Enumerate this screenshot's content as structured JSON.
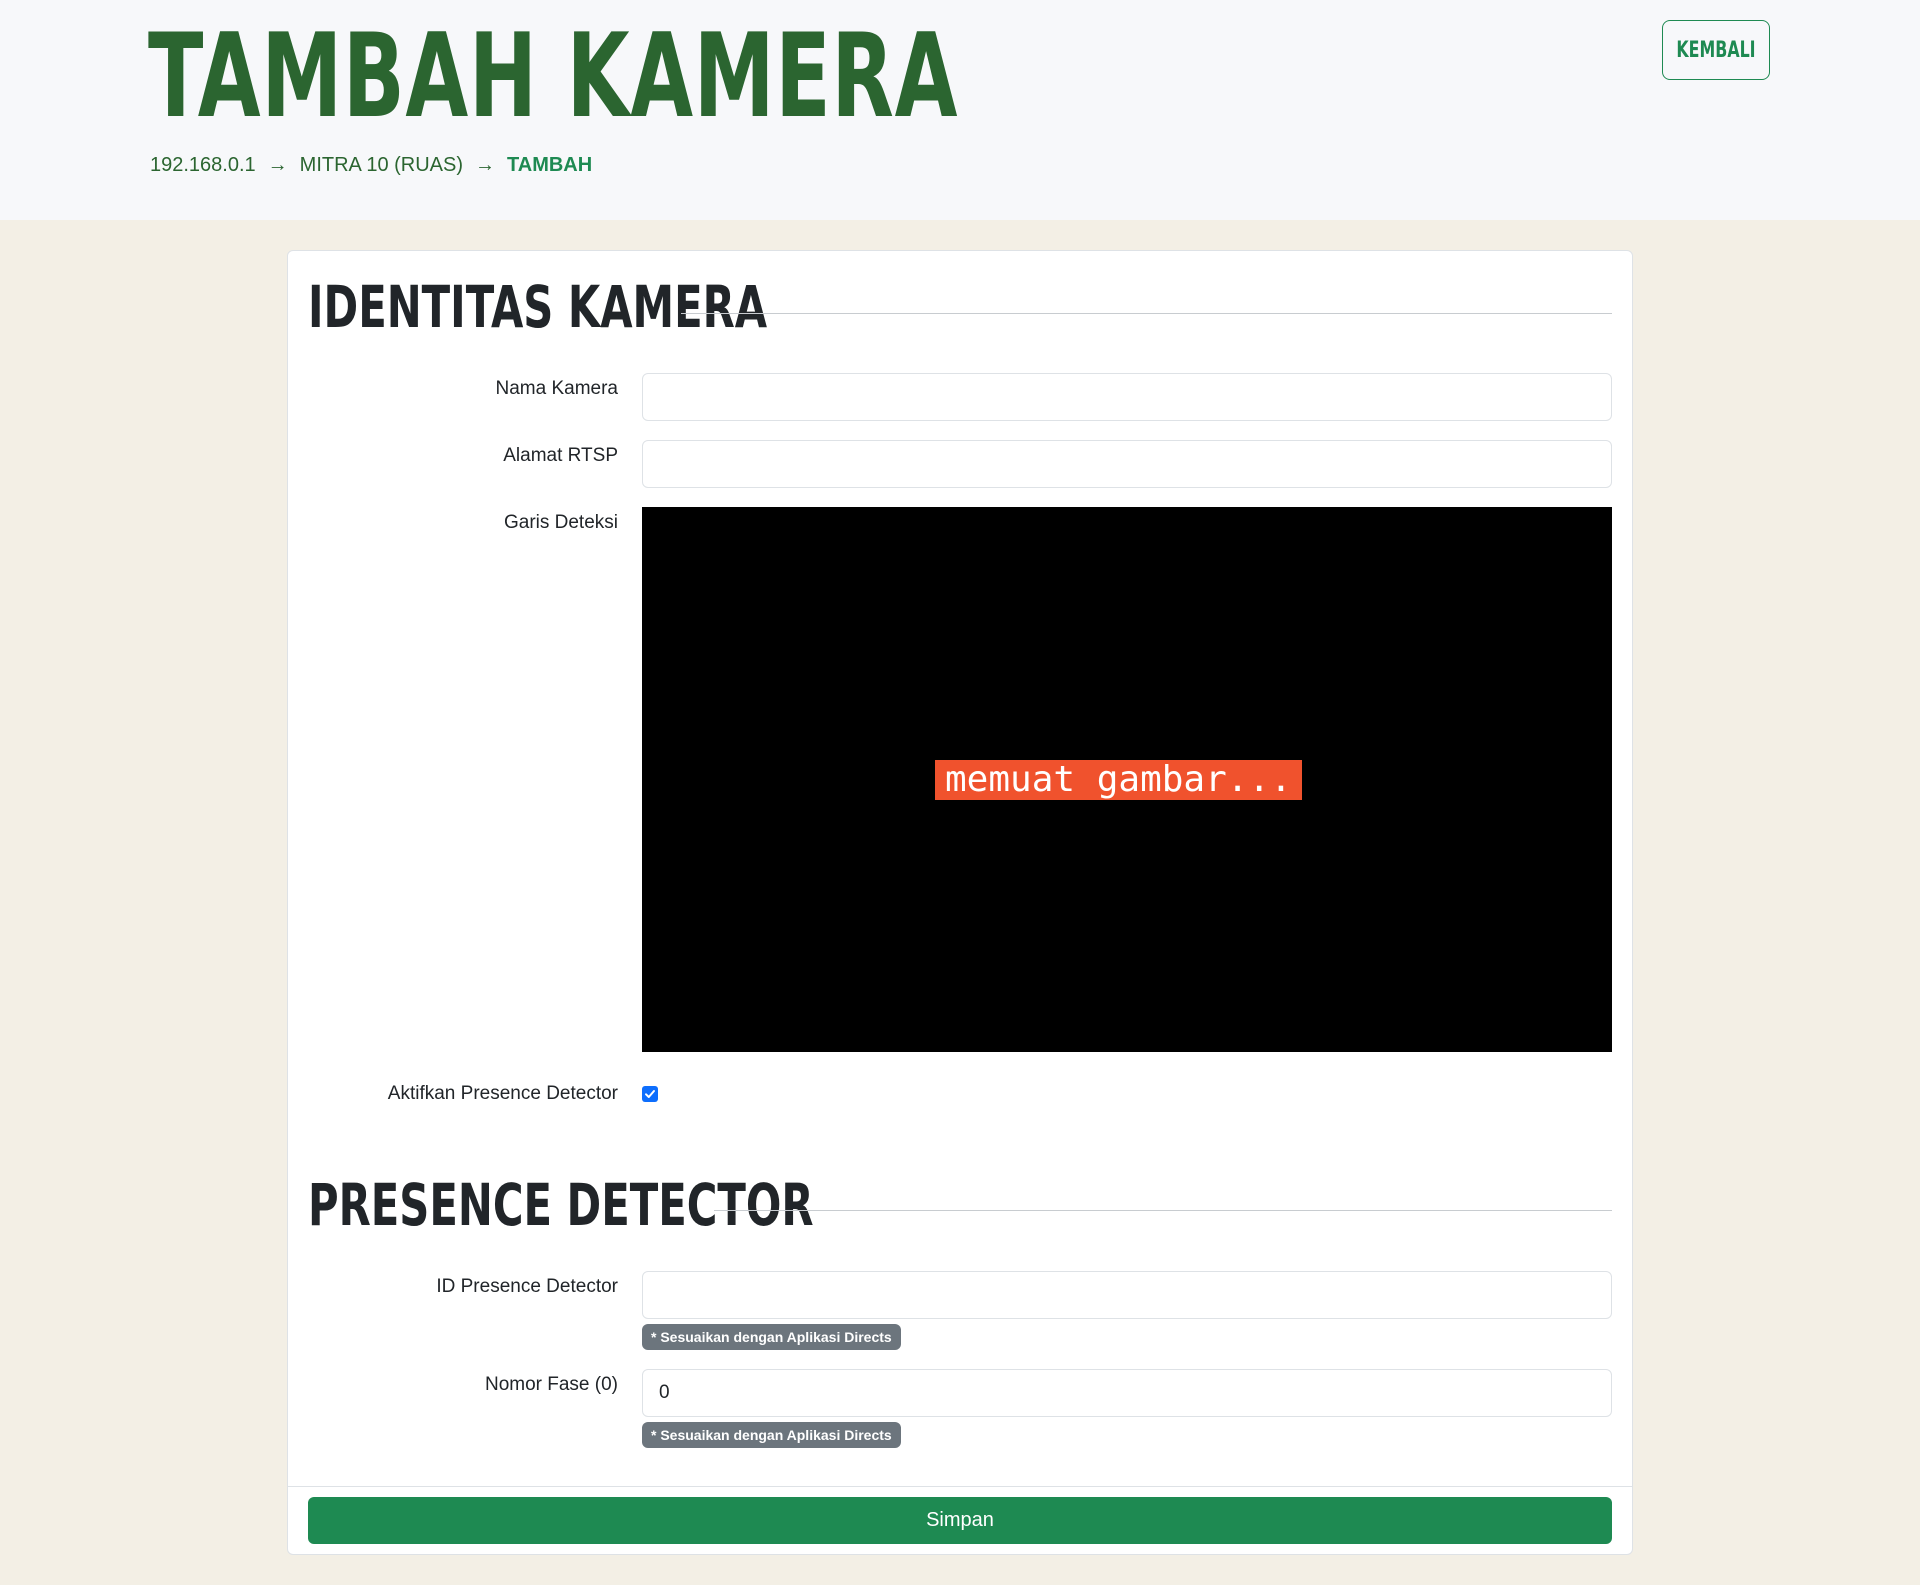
{
  "header": {
    "title": "TAMBAH KAMERA",
    "breadcrumb": [
      "192.168.0.1",
      "MITRA 10 (RUAS)",
      "TAMBAH"
    ],
    "separator": "→",
    "back_label": "KEMBALI"
  },
  "identity": {
    "title": "IDENTITAS KAMERA",
    "name_label": "Nama Kamera",
    "name_value": "",
    "rtsp_label": "Alamat RTSP",
    "rtsp_value": "",
    "line_label": "Garis Deteksi",
    "preview_status": "memuat gambar...",
    "presence_toggle_label": "Aktifkan Presence Detector",
    "presence_toggle_checked": true
  },
  "presence": {
    "title": "PRESENCE DETECTOR",
    "id_label": "ID Presence Detector",
    "id_value": "",
    "id_hint": "* Sesuaikan dengan Aplikasi Directs",
    "phase_label": "Nomor Fase (0)",
    "phase_value": "0",
    "phase_hint": "* Sesuaikan dengan Aplikasi Directs"
  },
  "actions": {
    "save_label": "Simpan"
  },
  "colors": {
    "brand_green": "#2b6530",
    "accent_green": "#1e8a52",
    "loading_badge": "#f0522d",
    "hint_badge": "#6c757d"
  }
}
